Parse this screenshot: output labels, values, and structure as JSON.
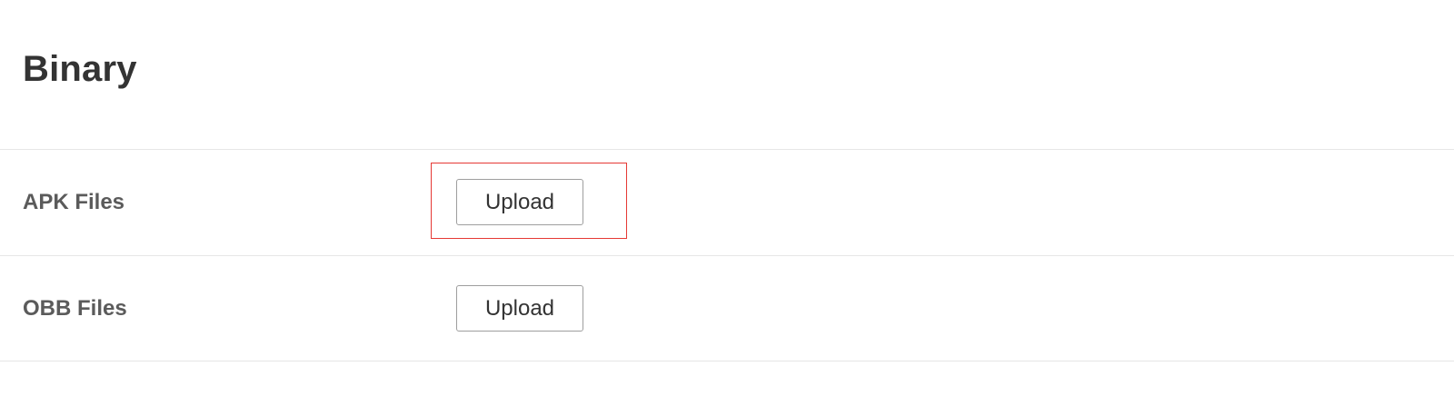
{
  "section": {
    "title": "Binary"
  },
  "rows": [
    {
      "label": "APK Files",
      "button_label": "Upload"
    },
    {
      "label": "OBB Files",
      "button_label": "Upload"
    }
  ],
  "colors": {
    "title_text": "#333333",
    "label_text": "#5b5b5b",
    "divider": "#e6e6e6",
    "button_border": "#9e9e9e",
    "highlight": "#e53935"
  }
}
